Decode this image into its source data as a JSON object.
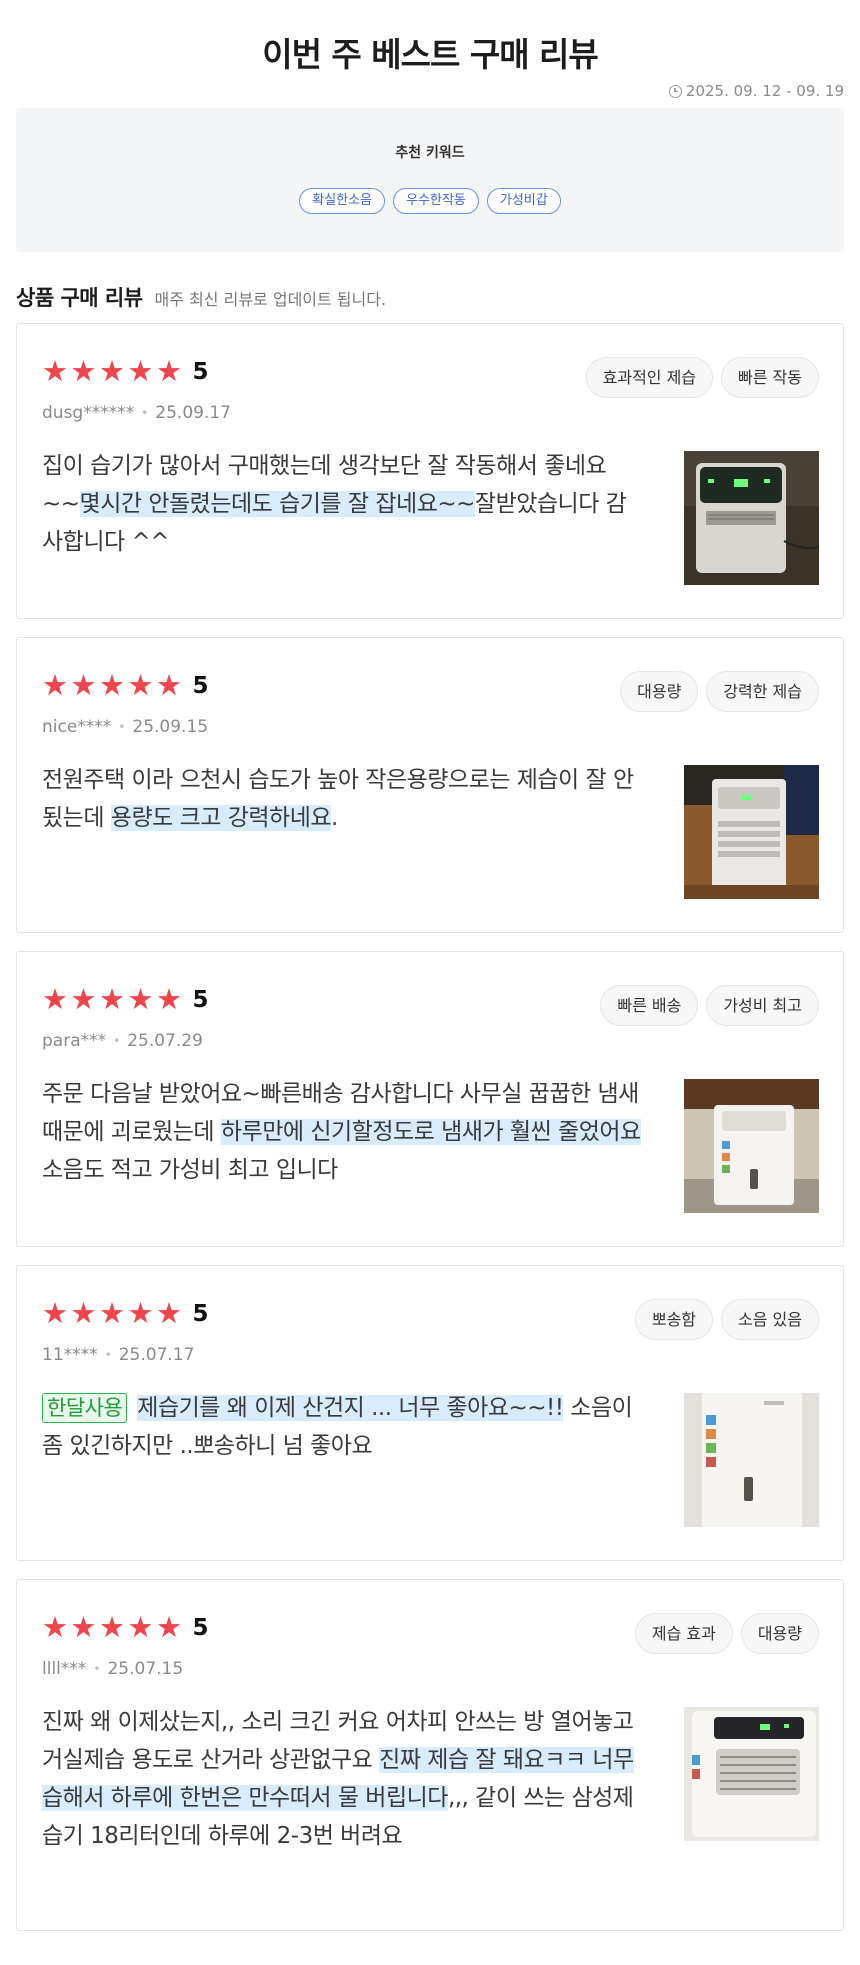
{
  "header": {
    "title": "이번 주 베스트 구매 리뷰",
    "date_range": "2025. 09. 12 - 09. 19"
  },
  "keywords": {
    "title": "추천 키워드",
    "items": [
      "확실한소음",
      "우수한작동",
      "가성비갑"
    ]
  },
  "section": {
    "title": "상품 구매 리뷰",
    "subtitle": "매주 최신 리뷰로 업데이트 됩니다."
  },
  "reviews": [
    {
      "rating": "5",
      "user": "dusg******",
      "date": "25.09.17",
      "tags": [
        "효과적인 제습",
        "빠른 작동"
      ],
      "text_before": "집이 습기가 많아서 구매했는데 생각보단 잘 작동해서 좋네요~~",
      "text_highlight": "몇시간 안돌렸는데도 습기를 잘 잡네요~~",
      "text_after": "잘받았습니다 감사합니다 ^^"
    },
    {
      "rating": "5",
      "user": "nice****",
      "date": "25.09.15",
      "tags": [
        "대용량",
        "강력한 제습"
      ],
      "text_before": "전원주택 이라 으천시 습도가 높아 작은용량으로는 제습이 잘 안 됬는데 ",
      "text_highlight": "용량도 크고 강력하네요",
      "text_after": "."
    },
    {
      "rating": "5",
      "user": "para***",
      "date": "25.07.29",
      "tags": [
        "빠른 배송",
        "가성비 최고"
      ],
      "text_before": "주문 다음날 받았어요~빠른배송 감사합니다 사무실 꿉꿉한 냄새 때문에 괴로웠는데 ",
      "text_highlight": "하루만에 신기할정도로 냄새가 훨씬 줄었어요",
      "text_after": " 소음도 적고 가성비 최고 입니다"
    },
    {
      "rating": "5",
      "user": "11****",
      "date": "25.07.17",
      "tags": [
        "뽀송함",
        "소음 있음"
      ],
      "badge": "한달사용",
      "text_before": "",
      "text_highlight": "제습기를 왜 이제 산건지 ... 너무 좋아요~~!!",
      "text_after": " 소음이 좀 있긴하지만 ..뽀송하니 넘 좋아요"
    },
    {
      "rating": "5",
      "user": "llll***",
      "date": "25.07.15",
      "tags": [
        "제습 효과",
        "대용량"
      ],
      "text_before": "진짜 왜 이제샀는지,, 소리 크긴 커요 어차피 안쓰는 방 열어놓고 거실제습 용도로 산거라 상관없구요 ",
      "text_highlight": "진짜 제습 잘 돼요ㅋㅋ 너무 습해서 하루에 한번은 만수떠서 물 버립니다",
      "text_after": ",,, 같이 쓰는 삼성제습기 18리터인데 하루에 2-3번 버려요"
    }
  ],
  "colors": {
    "star": "#f0464b",
    "highlight": "#d9ecfd",
    "keyword_chip": "#3d63d8",
    "badge_green": "#1e9c38"
  }
}
